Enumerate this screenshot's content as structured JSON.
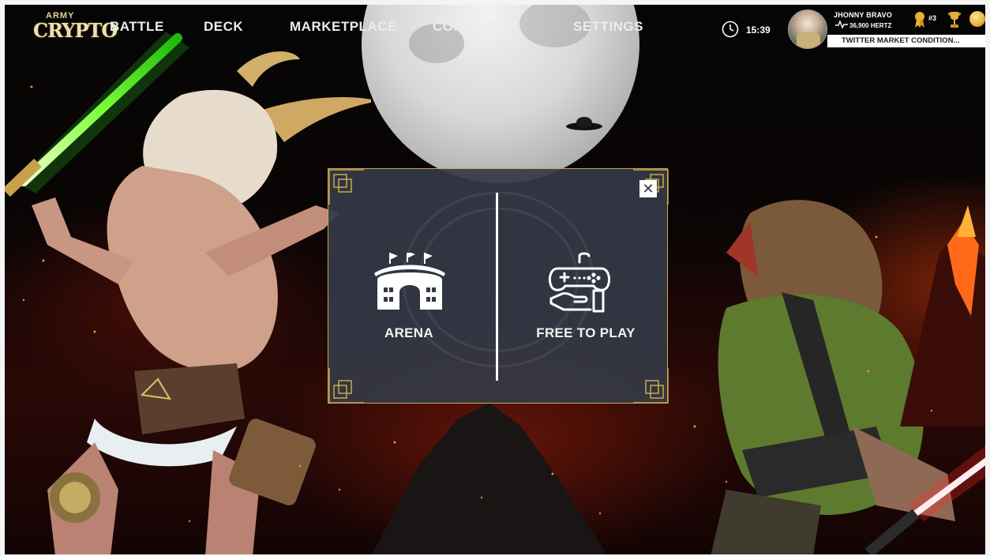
{
  "brand": {
    "logo_small": "ARMY",
    "logo_big": "CRYPTO"
  },
  "nav": {
    "items": [
      {
        "label": "BATTLE"
      },
      {
        "label": "DECK"
      },
      {
        "label": "MARKETPLACE"
      },
      {
        "label": "COMMUNITY"
      },
      {
        "label": "SETTINGS"
      }
    ]
  },
  "status": {
    "time": "15:39"
  },
  "profile": {
    "name": "JHONNY BRAVO",
    "hertz": "36,900 HERTZ",
    "rank": "#3",
    "ticker": "TWITTER MARKET CONDITION..."
  },
  "modal": {
    "options": [
      {
        "label": "ARENA",
        "icon": "arena-icon"
      },
      {
        "label": "FREE TO PLAY",
        "icon": "gamepad-hand-icon"
      }
    ],
    "close_label": "✕"
  },
  "colors": {
    "modal_bg": "#343a47",
    "gold_accent": "#caa94a",
    "text": "#f2f2f2",
    "ticker_bg": "#ffffff"
  }
}
